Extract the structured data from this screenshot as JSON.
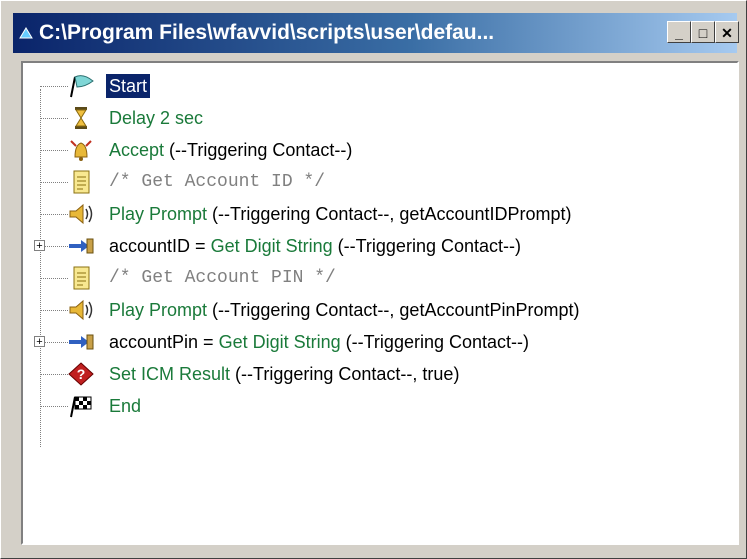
{
  "window": {
    "title": "C:\\Program Files\\wfavvid\\scripts\\user\\defau...",
    "minimize_label": "_",
    "maximize_label": "□",
    "close_label": "✕"
  },
  "tree": {
    "expander_symbol": "+",
    "nodes": [
      {
        "icon": "start-flag-icon",
        "text": "Start"
      },
      {
        "icon": "hourglass-icon",
        "text": "Delay 2 sec"
      },
      {
        "icon": "bell-icon",
        "text": "Accept",
        "params": " (--Triggering Contact--)"
      },
      {
        "icon": "note-icon",
        "text": "/* Get Account ID */"
      },
      {
        "icon": "speaker-icon",
        "text": "Play Prompt",
        "params": " (--Triggering Contact--, getAccountIDPrompt)"
      },
      {
        "icon": "get-digits-icon",
        "var": "accountID = ",
        "text": "Get Digit String",
        "params": " (--Triggering Contact--)"
      },
      {
        "icon": "note-icon",
        "text": "/* Get Account PIN */"
      },
      {
        "icon": "speaker-icon",
        "text": "Play Prompt",
        "params": " (--Triggering Contact--, getAccountPinPrompt)"
      },
      {
        "icon": "get-digits-icon",
        "var": "accountPin = ",
        "text": "Get Digit String",
        "params": " (--Triggering Contact--)"
      },
      {
        "icon": "icm-result-icon",
        "text": "Set ICM Result",
        "params": " (--Triggering Contact--, true)"
      },
      {
        "icon": "end-flag-icon",
        "text": "End"
      }
    ]
  },
  "colors": {
    "title_start": "#0a246a",
    "step_green": "#1a7a3a",
    "comment_gray": "#808080",
    "selection": "#0a246a"
  }
}
